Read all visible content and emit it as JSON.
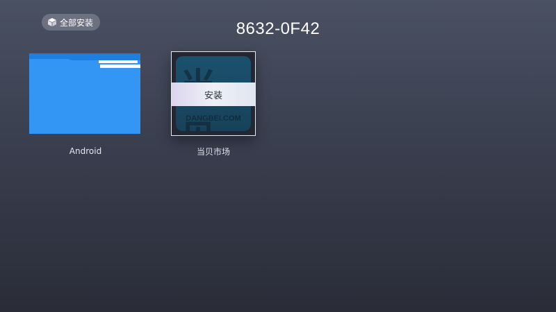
{
  "header": {
    "install_all_label": "全部安装",
    "title": "8632-0F42"
  },
  "items": [
    {
      "label": "Android",
      "icon": "folder-icon",
      "folder_color": "#3396f5"
    },
    {
      "label": "当贝市场",
      "icon": "app-icon",
      "icon_glyph": "当贝",
      "icon_domain": "DANGBEI.COM",
      "action_label": "安装",
      "selected": true
    }
  ]
}
